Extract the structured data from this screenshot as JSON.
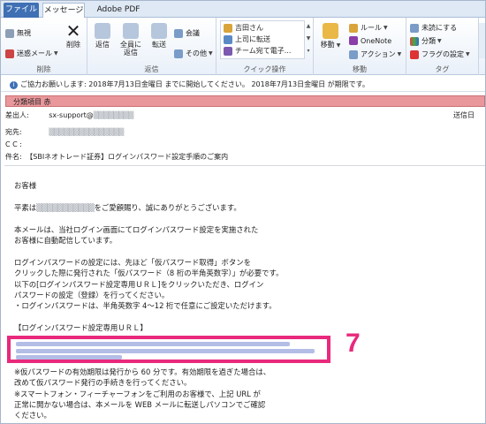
{
  "tabs": {
    "file": "ファイル",
    "message": "メッセージ",
    "adobe": "Adobe PDF"
  },
  "ribbon": {
    "delete_group": {
      "label": "削除",
      "ignore": "無視",
      "junk": "迷惑メール",
      "delete": "削除"
    },
    "respond_group": {
      "label": "返信",
      "reply": "返信",
      "reply_all_1": "全員に",
      "reply_all_2": "返信",
      "forward": "転送",
      "meeting": "会議",
      "more": "その他"
    },
    "quick_group": {
      "label": "クイック操作",
      "item1": "吉田さん",
      "item2": "上司に転送",
      "item3": "チーム宛て電子..."
    },
    "move_group": {
      "label": "移動",
      "move": "移動",
      "rules": "ルール",
      "onenote": "OneNote",
      "actions": "アクション"
    },
    "tags_group": {
      "label": "タグ",
      "unread": "未読にする",
      "categorize": "分類",
      "followup": "フラグの設定"
    }
  },
  "infobar": {
    "text": "ご協力お願いします: 2018年7月13日金曜日 までに開始してください。 2018年7月13日金曜日 が期限です。"
  },
  "category": {
    "text": "分類項目 赤"
  },
  "headers": {
    "from_label": "差出人:",
    "from_value": "sx-support@",
    "sent_label": "送信日",
    "to_label": "宛先:",
    "cc_label": "C C :",
    "subject_label": "件名:",
    "subject_value": "【SBIネオトレード証券】ログインパスワード設定手順のご案内"
  },
  "body": {
    "l1": "お客様",
    "l2a": "平素は",
    "l2b": "をご愛顧賜り、誠にありがとうございます。",
    "l3": "本メールは、当社ログイン画面にてログインパスワード設定を実施された",
    "l4": "お客様に自動配信しています。",
    "l5": "ログインパスワードの設定には、先ほど「仮パスワード取得」ボタンを",
    "l6": "クリックした際に発行された「仮パスワード（8 桁の半角英数字）」が必要です。",
    "l7": "以下の[ログインパスワード設定専用ＵＲＬ]をクリックいただき、ログイン",
    "l8": "パスワードの設定（登録）を行ってください。",
    "l9": "・ログインパスワードは、半角英数字 4～12 桁で任意にご設定いただけます。",
    "l10": "【ログインパスワード設定専用ＵＲＬ】",
    "l11": "※仮パスワードの有効期限は発行から 60 分です。有効期限を過ぎた場合は、",
    "l12": "改めて仮パスワード発行の手続きを行ってください。",
    "l13": "※スマートフォン・フィーチャーフォンをご利用のお客様で、上記 URL が",
    "l14": "正常に開かない場合は、本メールを WEB メールに転送しパソコンでご確認",
    "l15": "ください。"
  },
  "annotation": {
    "step": "7"
  },
  "colors": {
    "highlight": "#e8297c",
    "category": "#e9979b",
    "file_tab": "#3f70b4"
  }
}
